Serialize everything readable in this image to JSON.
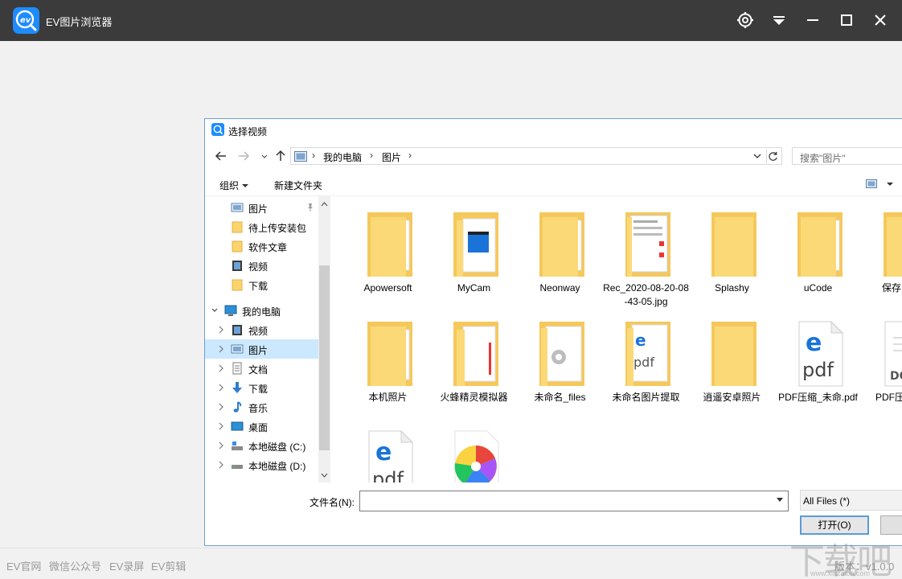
{
  "app": {
    "title": "EV图片浏览器",
    "accent": "#1e8bff",
    "titlebar_bg": "#3b3b3b",
    "controls": [
      "settings-icon",
      "dropdown-menu-icon",
      "minimize-icon",
      "maximize-icon",
      "close-icon"
    ]
  },
  "dialog": {
    "title": "选择视频",
    "address": {
      "crumbs": [
        "我的电脑",
        "图片"
      ],
      "separator": "›"
    },
    "search_placeholder": "搜索\"图片\"",
    "toolbar": {
      "organize": "组织",
      "new_folder": "新建文件夹"
    },
    "nav_pane": {
      "items": [
        {
          "label": "图片",
          "icon": "pictures-folder-icon",
          "pinned": true
        },
        {
          "label": "待上传安装包",
          "icon": "folder-icon"
        },
        {
          "label": "软件文章",
          "icon": "folder-icon"
        },
        {
          "label": "视频",
          "icon": "videos-folder-icon"
        },
        {
          "label": "下载",
          "icon": "folder-icon"
        },
        {
          "label": "我的电脑",
          "icon": "computer-icon",
          "expanded": true
        },
        {
          "label": "视频",
          "icon": "videos-folder-icon"
        },
        {
          "label": "图片",
          "icon": "pictures-folder-icon",
          "selected": true
        },
        {
          "label": "文档",
          "icon": "documents-icon"
        },
        {
          "label": "下载",
          "icon": "downloads-icon"
        },
        {
          "label": "音乐",
          "icon": "music-icon"
        },
        {
          "label": "桌面",
          "icon": "desktop-icon"
        },
        {
          "label": "本地磁盘 (C:)",
          "icon": "drive-c-icon"
        },
        {
          "label": "本地磁盘 (D:)",
          "icon": "drive-d-icon"
        }
      ]
    },
    "files": [
      {
        "name": "Apowersoft",
        "type": "folder-docs"
      },
      {
        "name": "MyCam",
        "type": "folder-video"
      },
      {
        "name": "Neonway",
        "type": "folder-docs"
      },
      {
        "name": "Rec_2020-08-20-08-43-05.jpg",
        "type": "folder-screens"
      },
      {
        "name": "Splashy",
        "type": "folder-empty"
      },
      {
        "name": "uCode",
        "type": "folder-docs"
      },
      {
        "name": "保存的",
        "type": "folder-empty"
      },
      {
        "name": "本机照片",
        "type": "folder-docs"
      },
      {
        "name": "火蜂精灵模拟器",
        "type": "folder-red"
      },
      {
        "name": "未命名_files",
        "type": "folder-gear"
      },
      {
        "name": "未命名图片提取",
        "type": "folder-pdf"
      },
      {
        "name": "逍遥安卓照片",
        "type": "folder-empty"
      },
      {
        "name": "PDF压缩_未命.pdf",
        "type": "pdf"
      },
      {
        "name": "PDF压缩_new.do",
        "type": "doc"
      },
      {
        "name": "",
        "type": "pdf"
      },
      {
        "name": "",
        "type": "photos-app"
      }
    ],
    "filename_label": "文件名(N):",
    "filename_value": "",
    "filetype_value": "All Files  (*)",
    "open_button": "打开(O)"
  },
  "footer": {
    "links": [
      "EV官网",
      "微信公众号",
      "EV录屏",
      "EV剪辑"
    ],
    "version": "版本：v1.0.0"
  },
  "watermark": {
    "text": "下载吧",
    "sub": "www.xiazaiba.com"
  }
}
